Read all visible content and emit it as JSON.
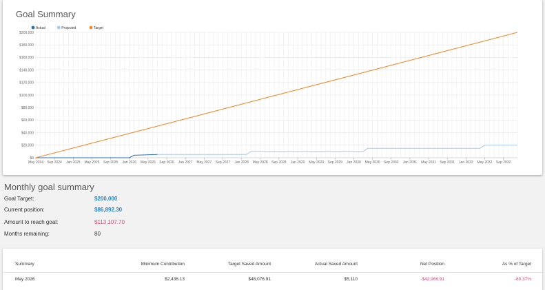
{
  "card": {
    "title": "Goal Summary"
  },
  "chart_data": {
    "type": "line",
    "legend": [
      {
        "name": "Actual",
        "color": "#2b6fb3"
      },
      {
        "name": "Projected",
        "color": "#a9c8ea"
      },
      {
        "name": "Target",
        "color": "#f08a2c"
      }
    ],
    "y_ticks": [
      "$0",
      "$20,000",
      "$40,000",
      "$60,000",
      "$80,000",
      "$100,000",
      "$120,000",
      "$140,000",
      "$160,000",
      "$180,000",
      "$200,000"
    ],
    "ylim": [
      0,
      200000
    ],
    "x_ticks": [
      "May 2024",
      "Sep 2024",
      "Jan 2025",
      "May 2025",
      "Sep 2025",
      "Jan 2026",
      "May 2026",
      "Sep 2026",
      "Jan 2027",
      "May 2027",
      "Sep 2027",
      "Jan 2028",
      "May 2028",
      "Sep 2028",
      "Jan 2029",
      "May 2029",
      "Sep 2029",
      "Jan 2030",
      "May 2030",
      "Sep 2030",
      "Jan 2031",
      "May 2031",
      "Sep 2031",
      "Jan 2032",
      "May 2032",
      "Sep 2032"
    ],
    "x_range_months": 103,
    "grid": true,
    "series": [
      {
        "name": "Target",
        "color": "#f08a2c",
        "points": [
          [
            0,
            0
          ],
          [
            103,
            200000
          ]
        ]
      },
      {
        "name": "Actual",
        "color": "#2b6fb3",
        "points": [
          [
            0,
            0
          ],
          [
            20,
            0
          ],
          [
            21,
            4000
          ],
          [
            26,
            5110
          ]
        ]
      },
      {
        "name": "Projected",
        "color": "#a9c8ea",
        "points": [
          [
            26,
            5110
          ],
          [
            45,
            5110
          ],
          [
            46,
            10000
          ],
          [
            70,
            10000
          ],
          [
            71,
            15000
          ],
          [
            95,
            15000
          ],
          [
            96,
            20000
          ],
          [
            103,
            20000
          ]
        ]
      }
    ]
  },
  "summary": {
    "title": "Monthly goal summary",
    "rows": [
      {
        "label": "Goal Target:",
        "value": "$200,000"
      },
      {
        "label": "Current position:",
        "value": "$86,892.30"
      },
      {
        "label": "Amount to reach goal:",
        "value": "$113,107.70"
      },
      {
        "label": "Months remaining:",
        "value": "80"
      }
    ]
  },
  "table": {
    "headers": [
      "Summary",
      "Minimum Contribution",
      "Target Saved Amount",
      "Actual Saved Amount",
      "Net Position",
      "As % of Target"
    ],
    "rows": [
      [
        "May 2026",
        "$2,436.13",
        "$48,076.91",
        "$5,110",
        "-$42,966.91",
        "-89.37%"
      ]
    ]
  }
}
